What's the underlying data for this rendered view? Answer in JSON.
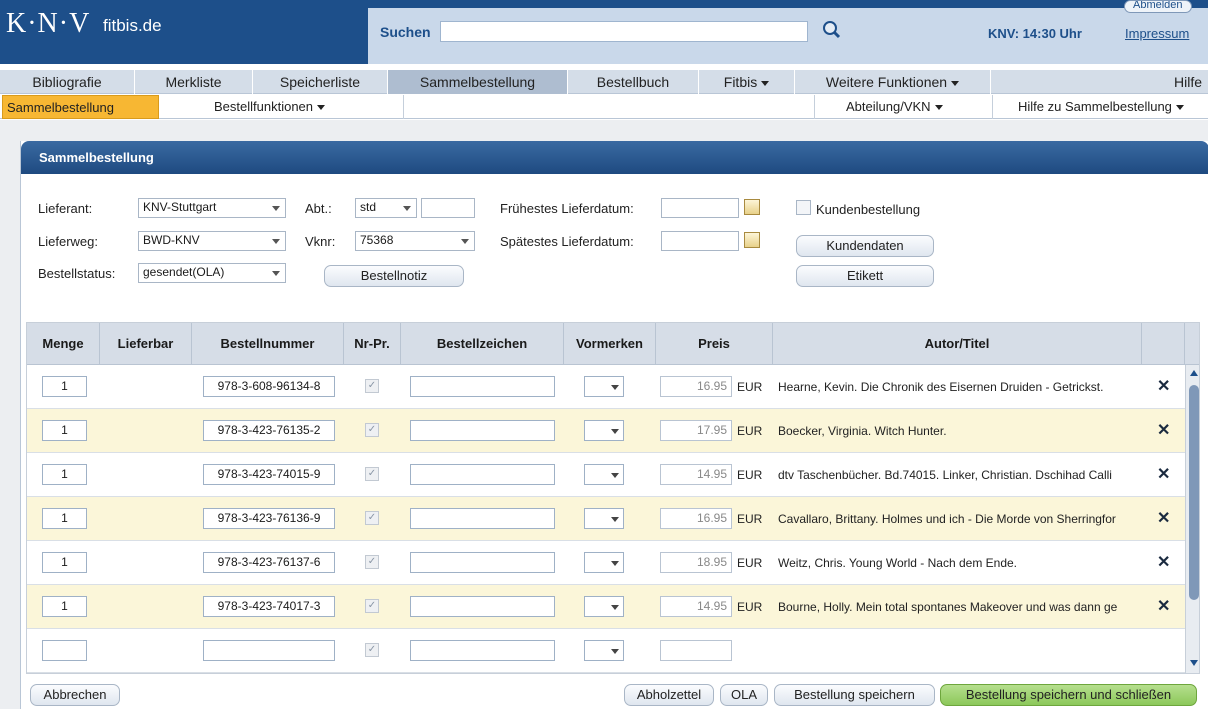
{
  "header": {
    "logo": "K·N·V",
    "site": "fitbis.de",
    "search_label": "Suchen",
    "search_value": "",
    "clock": "KNV: 14:30 Uhr",
    "impressum": "Impressum",
    "abmelden": "Abmelden"
  },
  "nav1": {
    "items": [
      "Bibliografie",
      "Merkliste",
      "Speicherliste",
      "Sammelbestellung",
      "Bestellbuch",
      "Fitbis",
      "Weitere Funktionen",
      "Hilfe"
    ]
  },
  "nav2": {
    "active": "Sammelbestellung",
    "bestellfunktionen": "Bestellfunktionen",
    "abteilung": "Abteilung/VKN",
    "hilfe_sammel": "Hilfe zu Sammelbestellung"
  },
  "panel": {
    "title": "Sammelbestellung"
  },
  "form": {
    "lieferant_label": "Lieferant:",
    "lieferant_value": "KNV-Stuttgart",
    "lieferweg_label": "Lieferweg:",
    "lieferweg_value": "BWD-KNV",
    "bestellstatus_label": "Bestellstatus:",
    "bestellstatus_value": "gesendet(OLA)",
    "abt_label": "Abt.:",
    "abt_value": "std",
    "abt_extra": "",
    "vknr_label": "Vknr:",
    "vknr_value": "75368",
    "bestellnotiz_btn": "Bestellnotiz",
    "fruehestes_label": "Frühestes Lieferdatum:",
    "fruehestes_value": "",
    "spaetestes_label": "Spätestes Lieferdatum:",
    "spaetestes_value": "",
    "kundenbestellung_label": "Kundenbestellung",
    "kundendaten_btn": "Kundendaten",
    "etikett_btn": "Etikett"
  },
  "table": {
    "headers": [
      "Menge",
      "Lieferbar",
      "Bestellnummer",
      "Nr-Pr.",
      "Bestellzeichen",
      "Vormerken",
      "Preis",
      "Autor/Titel"
    ],
    "currency": "EUR",
    "rows": [
      {
        "menge": "1",
        "nummer": "978-3-608-96134-8",
        "preis": "16.95",
        "titel": "Hearne, Kevin. Die Chronik des Eisernen Druiden - Getrickst."
      },
      {
        "menge": "1",
        "nummer": "978-3-423-76135-2",
        "preis": "17.95",
        "titel": "Boecker, Virginia. Witch Hunter."
      },
      {
        "menge": "1",
        "nummer": "978-3-423-74015-9",
        "preis": "14.95",
        "titel": "dtv Taschenbücher. Bd.74015. Linker, Christian. Dschihad Calli"
      },
      {
        "menge": "1",
        "nummer": "978-3-423-76136-9",
        "preis": "16.95",
        "titel": "Cavallaro, Brittany. Holmes und ich - Die Morde von Sherringfor"
      },
      {
        "menge": "1",
        "nummer": "978-3-423-76137-6",
        "preis": "18.95",
        "titel": "Weitz, Chris. Young World - Nach dem Ende."
      },
      {
        "menge": "1",
        "nummer": "978-3-423-74017-3",
        "preis": "14.95",
        "titel": "Bourne, Holly. Mein total spontanes Makeover und was dann ge"
      },
      {
        "menge": "",
        "nummer": "",
        "preis": "",
        "titel": ""
      }
    ]
  },
  "footer": {
    "abbrechen": "Abbrechen",
    "abholzettel": "Abholzettel",
    "ola": "OLA",
    "speichern": "Bestellung speichern",
    "speichern_schliessen": "Bestellung speichern und schließen"
  }
}
